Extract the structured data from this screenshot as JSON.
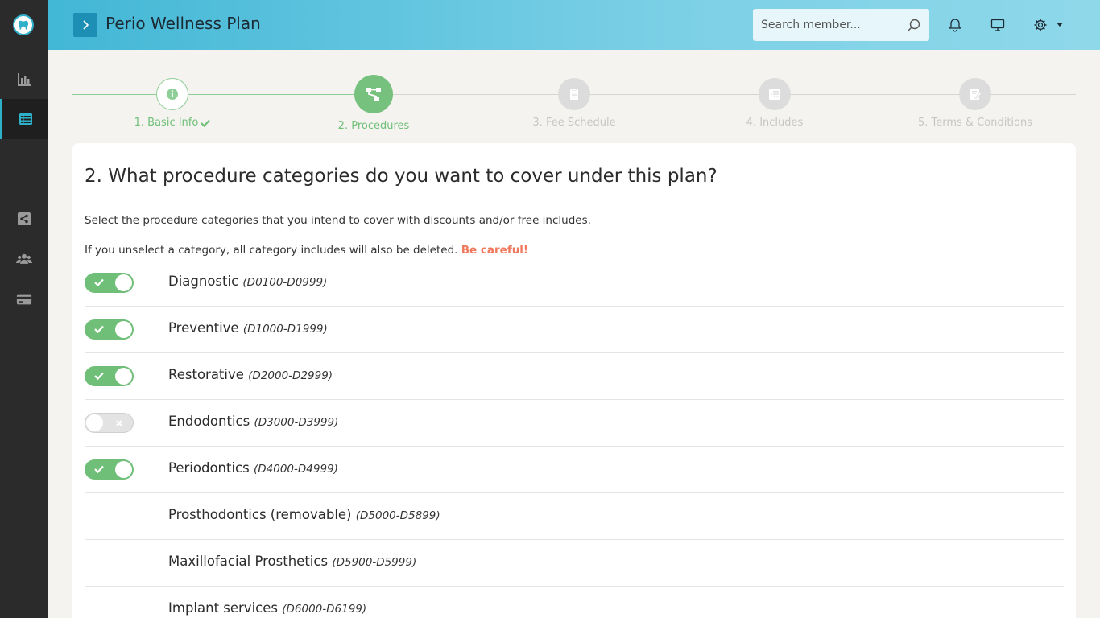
{
  "header": {
    "title": "Perio Wellness Plan",
    "search_placeholder": "Search member..."
  },
  "sidebar": {
    "items": [
      {
        "icon": "bar-chart-icon",
        "active": false
      },
      {
        "icon": "list-icon",
        "active": true
      },
      {
        "icon": "share-icon",
        "active": false
      },
      {
        "icon": "users-icon",
        "active": false
      },
      {
        "icon": "credit-card-icon",
        "active": false
      }
    ]
  },
  "stepper": {
    "steps": [
      {
        "label": "1. Basic Info",
        "state": "done",
        "icon": "info-icon"
      },
      {
        "label": "2. Procedures",
        "state": "active",
        "icon": "sitemap-icon"
      },
      {
        "label": "3. Fee Schedule",
        "state": "pending",
        "icon": "clipboard-icon"
      },
      {
        "label": "4. Includes",
        "state": "pending",
        "icon": "indent-list-icon"
      },
      {
        "label": "5. Terms & Conditions",
        "state": "pending",
        "icon": "signature-icon"
      }
    ]
  },
  "content": {
    "title": "2. What procedure categories do you want to cover under this plan?",
    "description": "Select the procedure categories that you intend to cover with discounts and/or free includes.",
    "warning_text": "If you unselect a category, all category includes will also be deleted. ",
    "warning_emphasis": "Be careful!",
    "accent_warning_color": "#f0795e",
    "accent_success_color": "#6fbf78"
  },
  "categories": [
    {
      "name": "Diagnostic",
      "range": "(D0100-D0999)",
      "toggle": "on"
    },
    {
      "name": "Preventive",
      "range": "(D1000-D1999)",
      "toggle": "on"
    },
    {
      "name": "Restorative",
      "range": "(D2000-D2999)",
      "toggle": "on"
    },
    {
      "name": "Endodontics",
      "range": "(D3000-D3999)",
      "toggle": "off"
    },
    {
      "name": "Periodontics",
      "range": "(D4000-D4999)",
      "toggle": "on"
    },
    {
      "name": "Prosthodontics (removable)",
      "range": "(D5000-D5899)",
      "toggle": "none"
    },
    {
      "name": "Maxillofacial Prosthetics",
      "range": "(D5900-D5999)",
      "toggle": "none"
    },
    {
      "name": "Implant services",
      "range": "(D6000-D6199)",
      "toggle": "none"
    }
  ]
}
